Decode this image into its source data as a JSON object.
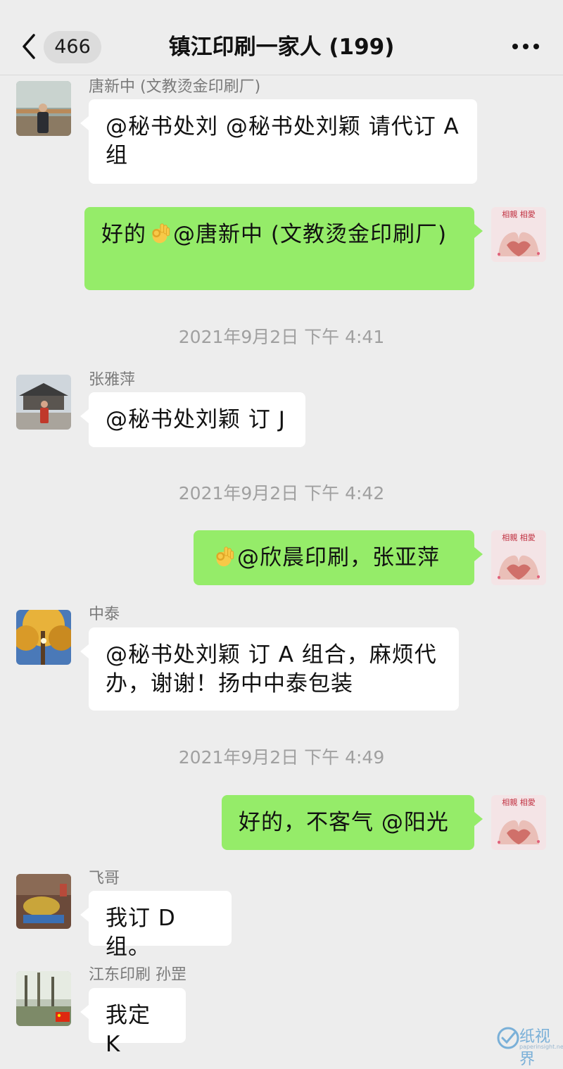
{
  "header": {
    "unread_count": "466",
    "title": "镇江印刷一家人 (199)"
  },
  "messages": [
    {
      "sender": "唐新中 (文教烫金印刷厂)",
      "text": "@秘书处刘 @秘书处刘颖 请代订 A 组"
    },
    {
      "text_before": "好的",
      "text_after": "@唐新中 (文教烫金印刷厂)"
    },
    {
      "timestamp": "2021年9月2日 下午 4:41"
    },
    {
      "sender": "张雅萍",
      "text": "@秘书处刘颖 订 J"
    },
    {
      "timestamp": "2021年9月2日 下午 4:42"
    },
    {
      "text_after": "@欣晨印刷，张亚萍"
    },
    {
      "sender": "中泰",
      "text": "@秘书处刘颖  订 A 组合，麻烦代办，谢谢！扬中中泰包装"
    },
    {
      "timestamp": "2021年9月2日 下午 4:49"
    },
    {
      "text": "好的，不客气 @阳光"
    },
    {
      "sender": "飞哥",
      "text": "我订 D 组。"
    },
    {
      "sender": "江东印刷  孙罡",
      "text": "我定 K"
    }
  ],
  "self_avatar": {
    "caption": "相親 相愛"
  },
  "watermark": {
    "name": "纸视界",
    "url": "paperinsight.net"
  },
  "colors": {
    "background": "#ededed",
    "incoming_bubble": "#ffffff",
    "outgoing_bubble": "#95ec69",
    "timestamp_text": "#a0a0a0"
  }
}
